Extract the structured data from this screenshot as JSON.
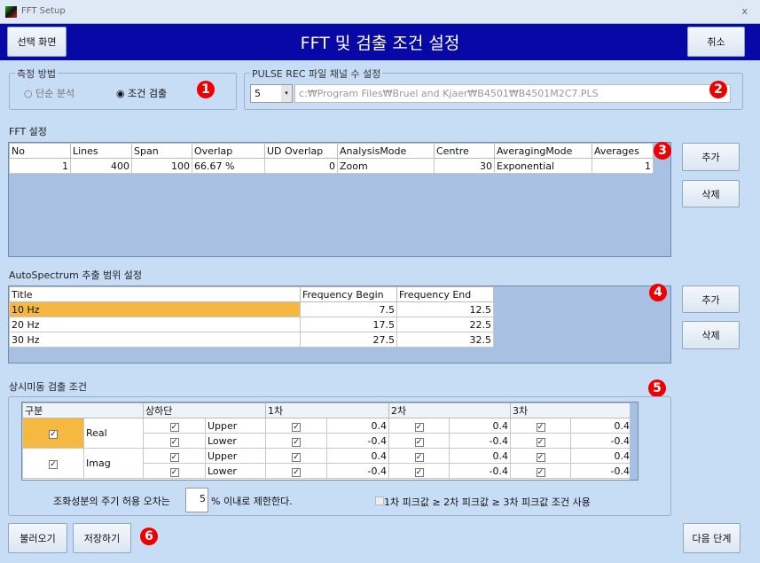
{
  "window": {
    "title": "FFT Setup",
    "close": "x"
  },
  "header": {
    "title": "FFT 및 검출 조건 설정",
    "left_button": "선택 화면",
    "cancel_button": "취소"
  },
  "measure": {
    "label": "측정 방법",
    "options": [
      "단순 분석",
      "조건 검출"
    ],
    "selected": "조건 검출"
  },
  "pulse": {
    "label": "PULSE REC 파일 채널 수 설정",
    "channels": "5",
    "path": "c:₩Program Files₩Bruel and Kjaer₩B4501₩B4501M2C7.PLS"
  },
  "fft": {
    "label": "FFT 설정",
    "columns": [
      "No",
      "Lines",
      "Span",
      "Overlap",
      "UD Overlap",
      "AnalysisMode",
      "Centre",
      "AveragingMode",
      "Averages"
    ],
    "rows": [
      [
        "1",
        "400",
        "100",
        "66.67 %",
        "0",
        "Zoom",
        "30",
        "Exponential",
        "1"
      ]
    ],
    "add": "추가",
    "delete": "삭제"
  },
  "auto": {
    "label": "AutoSpectrum 추출 범위 설정",
    "columns": [
      "Title",
      "Frequency Begin",
      "Frequency End"
    ],
    "rows": [
      [
        "10 Hz",
        "7.5",
        "12.5"
      ],
      [
        "20 Hz",
        "17.5",
        "22.5"
      ],
      [
        "30 Hz",
        "27.5",
        "32.5"
      ]
    ],
    "add": "추가",
    "delete": "삭제",
    "highlight": "#f5b942"
  },
  "detect": {
    "label": "상시미동 검출 조건",
    "columns": [
      "구분",
      "상하단",
      "1차",
      "2차",
      "3차"
    ],
    "groups": [
      {
        "name": "Real",
        "rows": [
          {
            "bound": "Upper",
            "v": [
              "0.4",
              "0.4",
              "0.4"
            ]
          },
          {
            "bound": "Lower",
            "v": [
              "-0.4",
              "-0.4",
              "-0.4"
            ]
          }
        ]
      },
      {
        "name": "Imag",
        "rows": [
          {
            "bound": "Upper",
            "v": [
              "0.4",
              "0.4",
              "0.4"
            ]
          },
          {
            "bound": "Lower",
            "v": [
              "-0.4",
              "-0.4",
              "-0.4"
            ]
          }
        ]
      }
    ],
    "tolerance_prefix": "조화성분의 주기 허용 오차는",
    "tolerance_value": "5",
    "tolerance_suffix": "% 이내로 제한한다.",
    "peak_option": "1차 피크값 ≥  2차 피크값 ≥ 3차 피크값 조건 사용"
  },
  "footer": {
    "load": "불러오기",
    "save": "저장하기",
    "next": "다음 단계"
  },
  "badges": [
    "1",
    "2",
    "3",
    "4",
    "5",
    "6"
  ]
}
